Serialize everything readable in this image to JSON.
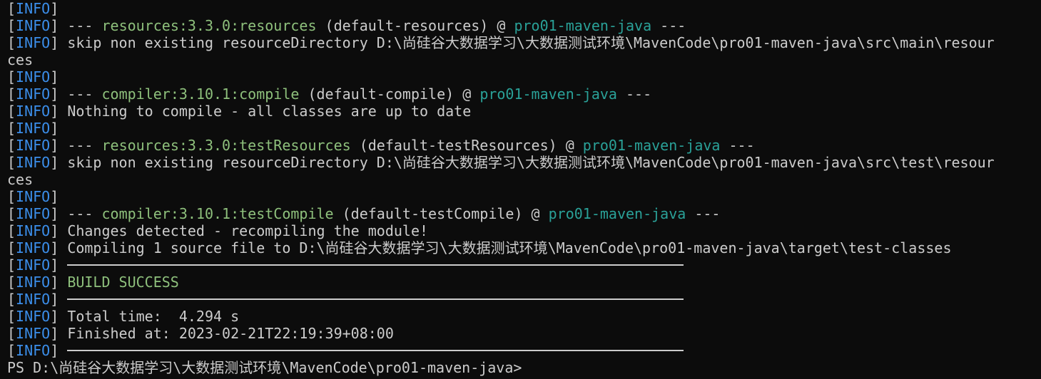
{
  "window": {
    "type": "terminal-output"
  },
  "colors": {
    "background": "#0c0c0c",
    "text": "#cccccc",
    "info_tag": "#3b8eea",
    "plugin": "#8ec07c",
    "project": "#2aa198",
    "success": "#8ec07c"
  },
  "lines": [
    {
      "kind": "info"
    },
    {
      "kind": "goal",
      "prefix": "--- ",
      "plugin": "resources:3.3.0:resources",
      "middle": " (default-resources) @ ",
      "project": "pro01-maven-java",
      "suffix": " ---"
    },
    {
      "kind": "text",
      "text": "skip non existing resourceDirectory D:\\尚硅谷大数据学习\\大数据测试环境\\MavenCode\\pro01-maven-java\\src\\main\\resour"
    },
    {
      "kind": "wrap",
      "text": "ces"
    },
    {
      "kind": "info"
    },
    {
      "kind": "goal",
      "prefix": "--- ",
      "plugin": "compiler:3.10.1:compile",
      "middle": " (default-compile) @ ",
      "project": "pro01-maven-java",
      "suffix": " ---"
    },
    {
      "kind": "text",
      "text": "Nothing to compile - all classes are up to date"
    },
    {
      "kind": "info"
    },
    {
      "kind": "goal",
      "prefix": "--- ",
      "plugin": "resources:3.3.0:testResources",
      "middle": " (default-testResources) @ ",
      "project": "pro01-maven-java",
      "suffix": " ---"
    },
    {
      "kind": "text",
      "text": "skip non existing resourceDirectory D:\\尚硅谷大数据学习\\大数据测试环境\\MavenCode\\pro01-maven-java\\src\\test\\resour"
    },
    {
      "kind": "wrap",
      "text": "ces"
    },
    {
      "kind": "info"
    },
    {
      "kind": "goal",
      "prefix": "--- ",
      "plugin": "compiler:3.10.1:testCompile",
      "middle": " (default-testCompile) @ ",
      "project": "pro01-maven-java",
      "suffix": " ---"
    },
    {
      "kind": "text",
      "text": "Changes detected - recompiling the module!"
    },
    {
      "kind": "text",
      "text": "Compiling 1 source file to D:\\尚硅谷大数据学习\\大数据测试环境\\MavenCode\\pro01-maven-java\\target\\test-classes"
    },
    {
      "kind": "rule"
    },
    {
      "kind": "success",
      "text": "BUILD SUCCESS"
    },
    {
      "kind": "rule"
    },
    {
      "kind": "text",
      "text": "Total time:  4.294 s"
    },
    {
      "kind": "text",
      "text": "Finished at: 2023-02-21T22:19:39+08:00"
    },
    {
      "kind": "rule"
    },
    {
      "kind": "prompt",
      "text": "PS D:\\尚硅谷大数据学习\\大数据测试环境\\MavenCode\\pro01-maven-java>"
    }
  ],
  "info_tag": {
    "open": "[",
    "label": "INFO",
    "close": "]"
  }
}
